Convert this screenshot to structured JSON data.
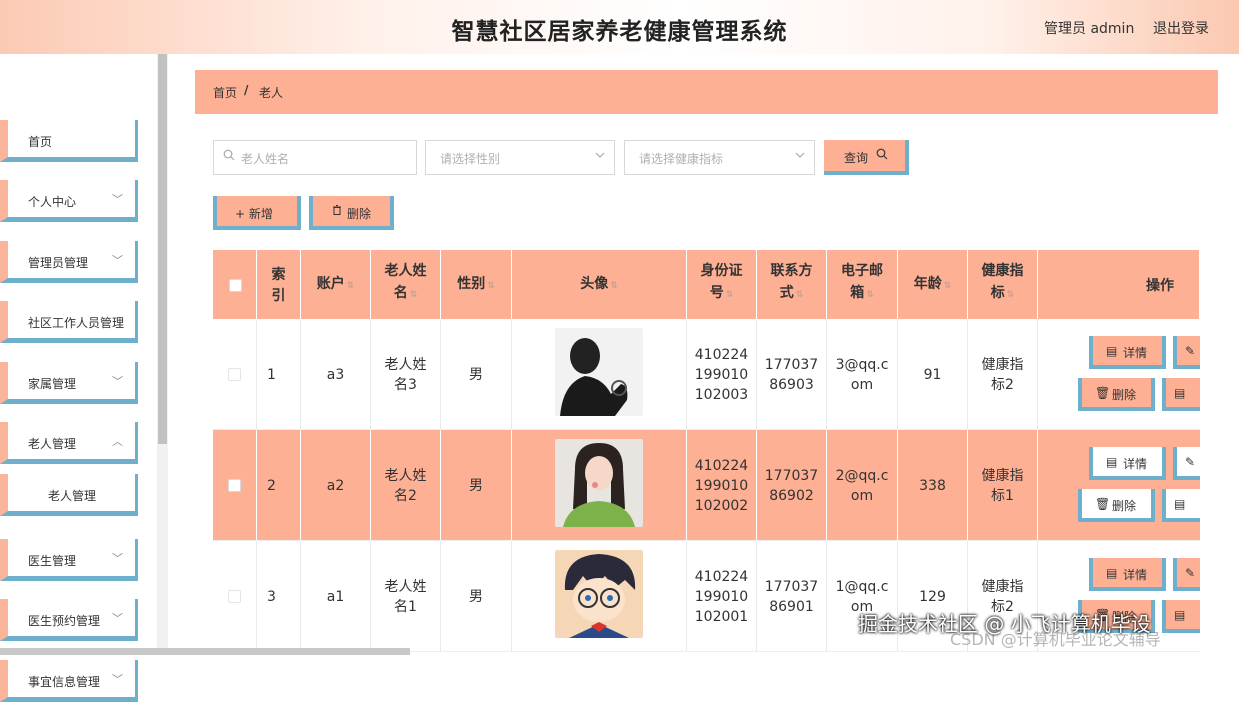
{
  "header": {
    "title": "智慧社区居家养老健康管理系统",
    "user": "管理员 admin",
    "logout": "退出登录"
  },
  "sidebar": {
    "items": [
      {
        "label": "首页",
        "chevron": ""
      },
      {
        "label": "个人中心",
        "chevron": "﹀"
      },
      {
        "label": "管理员管理",
        "chevron": "﹀"
      },
      {
        "label": "社区工作人员管理",
        "chevron": ""
      },
      {
        "label": "家属管理",
        "chevron": "﹀"
      },
      {
        "label": "老人管理",
        "chevron": "︿"
      },
      {
        "label": "老人管理",
        "chevron": ""
      },
      {
        "label": "医生管理",
        "chevron": "﹀"
      },
      {
        "label": "医生预约管理",
        "chevron": "﹀"
      },
      {
        "label": "事宜信息管理",
        "chevron": "﹀"
      }
    ]
  },
  "breadcrumb": {
    "home": "首页",
    "separator": "/",
    "current": "老人"
  },
  "search": {
    "name_placeholder": "老人姓名",
    "gender_placeholder": "请选择性别",
    "health_placeholder": "请选择健康指标",
    "query_label": "查询"
  },
  "toolbar": {
    "add_label": "+ 新增",
    "delete_label": "删除"
  },
  "table": {
    "headers": {
      "index": [
        "索",
        "引"
      ],
      "account": "账户",
      "name": [
        "老人姓",
        "名"
      ],
      "gender": "性别",
      "avatar": "头像",
      "idcard": [
        "身份证",
        "号"
      ],
      "phone": [
        "联系方",
        "式"
      ],
      "email": [
        "电子邮",
        "箱"
      ],
      "age": "年龄",
      "health": [
        "健康指",
        "标"
      ],
      "ops": "操作"
    },
    "rows": [
      {
        "index": "1",
        "account": "a3",
        "name": [
          "老人姓",
          "名3"
        ],
        "gender": "男",
        "idcard": [
          "410224",
          "199010",
          "102003"
        ],
        "phone": [
          "177037",
          "86903"
        ],
        "email": [
          "3@qq.c",
          "om"
        ],
        "age": "91",
        "health": [
          "健康指",
          "标2"
        ],
        "avatar_icon": "silhouette-photo"
      },
      {
        "index": "2",
        "account": "a2",
        "name": [
          "老人姓",
          "名2"
        ],
        "gender": "男",
        "idcard": [
          "410224",
          "199010",
          "102002"
        ],
        "phone": [
          "177037",
          "86902"
        ],
        "email": [
          "2@qq.c",
          "om"
        ],
        "age": "338",
        "health": [
          "健康指",
          "标1"
        ],
        "avatar_icon": "girl-photo"
      },
      {
        "index": "3",
        "account": "a1",
        "name": [
          "老人姓",
          "名1"
        ],
        "gender": "男",
        "idcard": [
          "410224",
          "199010",
          "102001"
        ],
        "phone": [
          "177037",
          "86901"
        ],
        "email": [
          "1@qq.c",
          "om"
        ],
        "age": "129",
        "health": [
          "健康指",
          "标2"
        ],
        "avatar_icon": "cartoon-photo"
      }
    ],
    "actions": {
      "detail": "详情",
      "delete": "删除"
    }
  },
  "watermark": {
    "line1": "掘金技术社区 @ 小飞计算机毕设",
    "line2": "CSDN @计算机毕业论文辅导"
  },
  "colors": {
    "accent": "#fdb094",
    "border_blue": "#6eb0cc"
  }
}
